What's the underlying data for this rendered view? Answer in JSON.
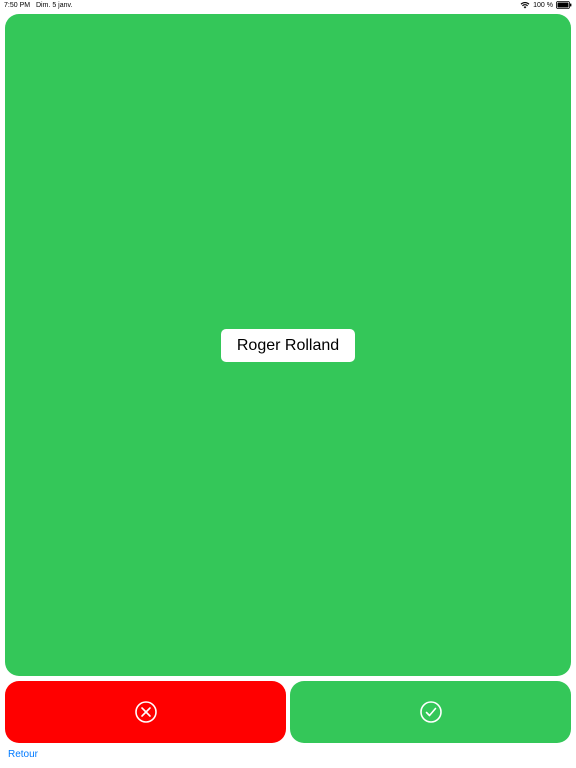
{
  "status_bar": {
    "time": "7:50 PM",
    "date": "Dim. 5 janv.",
    "battery": "100 %"
  },
  "card": {
    "name": "Roger Rolland"
  },
  "actions": {
    "reject_icon": "x-circle-icon",
    "accept_icon": "check-circle-icon"
  },
  "nav": {
    "back_label": "Retour"
  },
  "colors": {
    "card_green": "#34c759",
    "reject_red": "#ff0000",
    "link_blue": "#007aff"
  }
}
